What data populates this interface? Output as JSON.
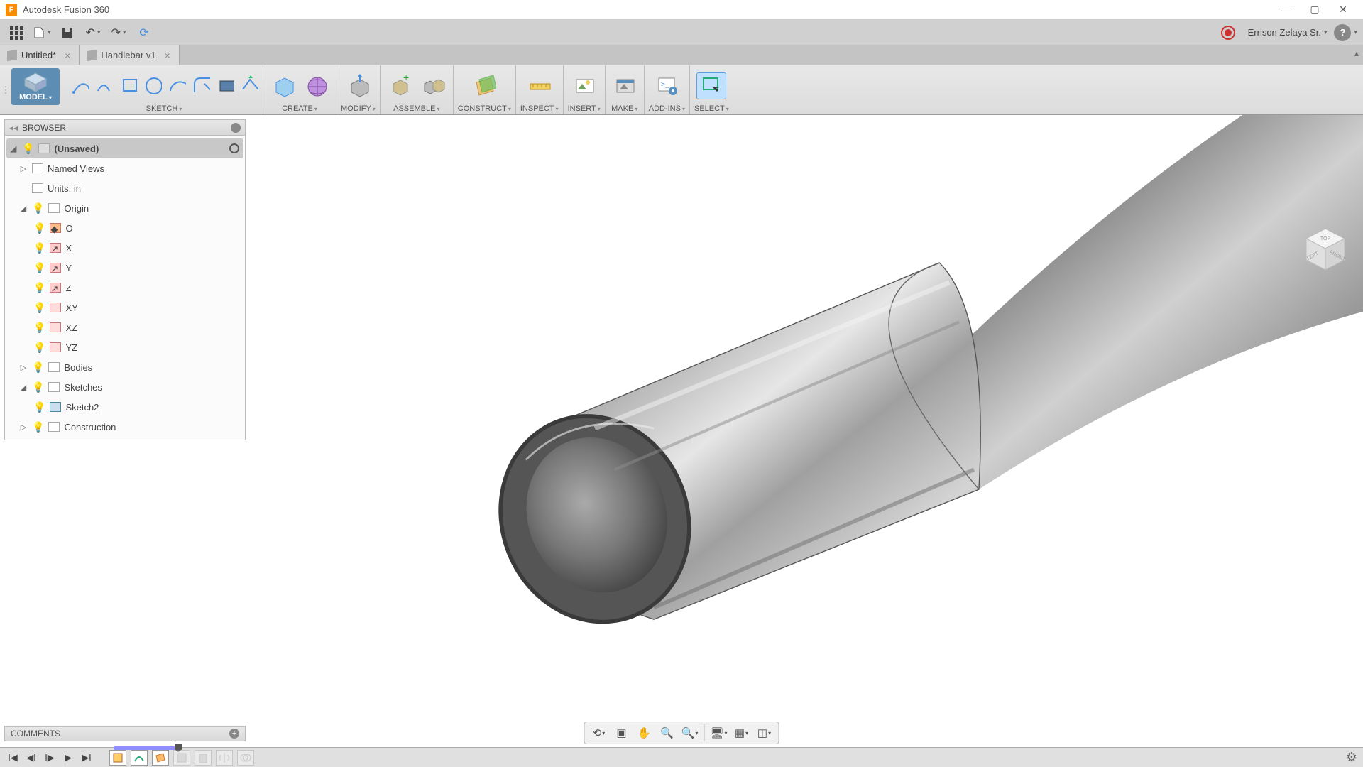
{
  "app": {
    "title": "Autodesk Fusion 360"
  },
  "user": {
    "name": "Errison Zelaya Sr."
  },
  "tabs": [
    {
      "label": "Untitled*",
      "active": true
    },
    {
      "label": "Handlebar v1",
      "active": false
    }
  ],
  "workspace": {
    "label": "MODEL"
  },
  "ribbon_groups": {
    "sketch": "SKETCH",
    "create": "CREATE",
    "modify": "MODIFY",
    "assemble": "ASSEMBLE",
    "construct": "CONSTRUCT",
    "inspect": "INSPECT",
    "insert": "INSERT",
    "make": "MAKE",
    "addins": "ADD-INS",
    "select": "SELECT"
  },
  "browser": {
    "title": "BROWSER",
    "root": "(Unsaved)",
    "named_views": "Named Views",
    "units": "Units: in",
    "origin": "Origin",
    "origin_children": {
      "o": "O",
      "x": "X",
      "y": "Y",
      "z": "Z",
      "xy": "XY",
      "xz": "XZ",
      "yz": "YZ"
    },
    "bodies": "Bodies",
    "sketches": "Sketches",
    "sketch2": "Sketch2",
    "construction": "Construction"
  },
  "comments": {
    "title": "COMMENTS"
  },
  "viewcube": {
    "top": "TOP",
    "left": "LEFT",
    "front": "FRONT"
  }
}
